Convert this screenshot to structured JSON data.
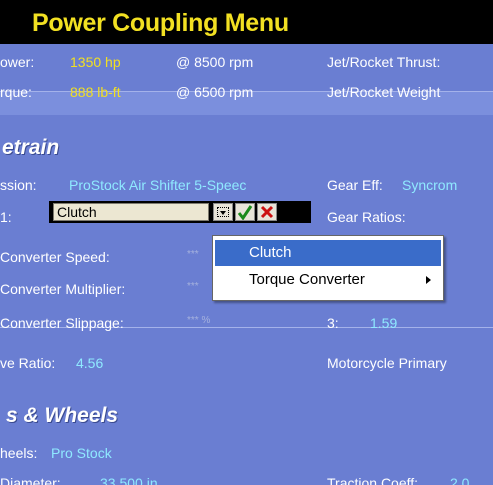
{
  "window": {
    "title": "Power Coupling Menu"
  },
  "engine": {
    "power_label": "ower:",
    "power_value": "1350 hp",
    "power_rpm": "@ 8500 rpm",
    "torque_label": "rque:",
    "torque_value": "888 lb-ft",
    "torque_rpm": "@ 6500 rpm",
    "jet_thrust_label": "Jet/Rocket Thrust:",
    "jet_weight_label": "Jet/Rocket Weight"
  },
  "drivetrain": {
    "heading": "etrain",
    "transmission_label": "ssion:",
    "transmission_value": "ProStock Air Shifter 5-Speec",
    "gear_eff_label": "Gear Eff:",
    "gear_eff_value": "Syncrom",
    "coupling_label": "1:",
    "gear_ratios_label": "Gear Ratios:",
    "converter_speed_label": "Converter Speed:",
    "converter_speed_value": "***",
    "converter_multiplier_label": "Converter Multiplier:",
    "converter_multiplier_value": "***",
    "converter_slippage_label": "Converter Slippage:",
    "converter_slippage_value": "*** %",
    "gear3_label": "3:",
    "gear3_value": "1.59",
    "drive_ratio_label": "ve Ratio:",
    "drive_ratio_value": "4.56",
    "moto_primary_label": "Motorcycle Primary"
  },
  "tires": {
    "heading": "s & Wheels",
    "wheels_label": "heels:",
    "wheels_value": "Pro Stock",
    "diameter_label": "Diameter:",
    "diameter_value": "33.500 in",
    "traction_label": "Traction Coeff:",
    "traction_value": "2.0"
  },
  "coupling_editor": {
    "field_value": "Clutch",
    "ok_icon": "check-icon",
    "cancel_icon": "x-icon",
    "dropdown_icon": "chevron-down-icon"
  },
  "coupling_menu": {
    "items": [
      {
        "label": "Clutch",
        "selected": true
      },
      {
        "label": "Torque Converter",
        "has_submenu": true
      }
    ]
  },
  "colors": {
    "title": "#f2e022",
    "panel_bg": "#6a7ed2",
    "value_cyan": "#8fe9ff",
    "menu_selected": "#3a6cc9"
  }
}
